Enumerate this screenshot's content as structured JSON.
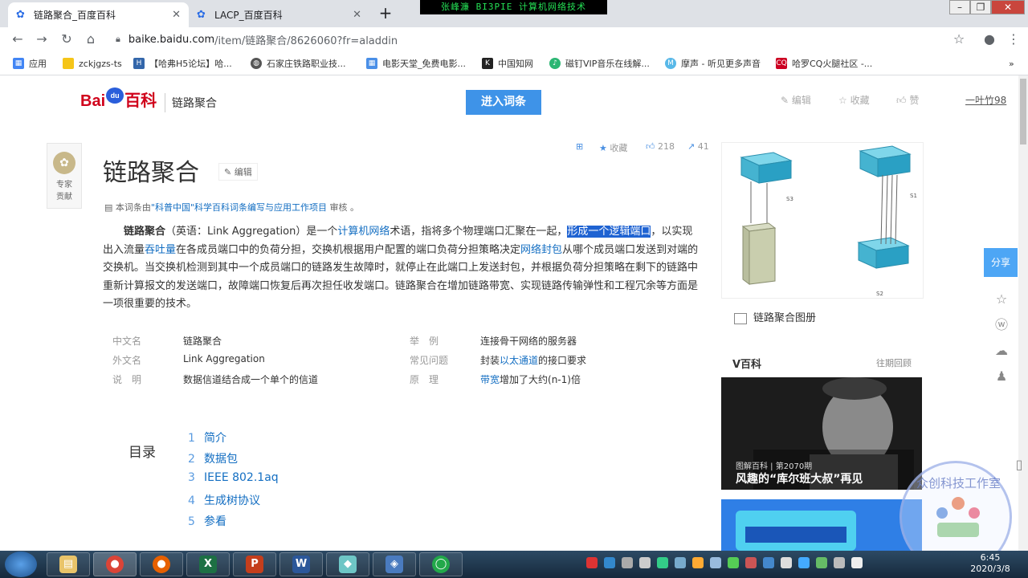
{
  "tabs": [
    {
      "label": "链路聚合_百度百科",
      "active": true
    },
    {
      "label": "LACP_百度百科",
      "active": false
    }
  ],
  "overlay_title": "张峰濂 BI3PIE 计算机网络技术",
  "address": {
    "host": "baike.baidu.com",
    "path": "/item/链路聚合/8626060?fr=aladdin"
  },
  "bookmarks": [
    "应用",
    "zckjgzs-ts",
    "【哈弗H5论坛】哈...",
    "石家庄铁路职业技...",
    "电影天堂_免费电影...",
    "中国知网",
    "磁钉VIP音乐在线解...",
    "摩声 - 听见更多声音",
    "哈罗CQ火腿社区 -..."
  ],
  "header": {
    "logo_main": "Bai",
    "logo_paw": "du",
    "logo_baike": "百科",
    "title": "链路聚合",
    "enter_button": "进入词条",
    "tools": [
      "编辑",
      "收藏",
      "赞"
    ],
    "user": "一叶竹98"
  },
  "contributor": {
    "label1": "专家",
    "label2": "贡献"
  },
  "article": {
    "title": "链路聚合",
    "edit": "编辑",
    "stats": {
      "favorite": "收藏",
      "likes": "218",
      "shares": "41"
    },
    "byline_prefix": "本词条由",
    "byline_link": "\"科普中国\"科学百科词条编写与应用工作项目",
    "byline_suffix": " 审核 。",
    "para": {
      "term": "链路聚合",
      "t1": "（英语：Link Aggregation）是一个",
      "l1": "计算机网络",
      "t2": "术语，指将多个物理端口汇聚在一起，",
      "sel": "形成一个逻辑端口",
      "t3": "，以实现出入流量",
      "l2": "吞吐量",
      "t4": "在各成员端口中的负荷分担，交换机根据用户配置的端口负荷分担策略决定",
      "l3": "网络封包",
      "t5": "从哪个成员端口发送到对端的交换机。当交换机检测到其中一个成员端口的链路发生故障时，就停止在此端口上发送封包，并根据负荷分担策略在剩下的链路中重新计算报文的发送端口，故障端口恢复后再次担任收发端口。链路聚合在增加链路带宽、实现链路传输弹性和工程冗余等方面是一项很重要的技术。"
    },
    "info_left": [
      {
        "k": "中文名",
        "v": "链路聚合"
      },
      {
        "k": "外文名",
        "v": "Link Aggregation"
      },
      {
        "k": "说　明",
        "v": "数据信道结合成一个单个的信道"
      }
    ],
    "info_right": [
      {
        "k": "举　例",
        "v": "连接骨干网络的服务器"
      },
      {
        "k": "常见问题",
        "v1": "封装",
        "link": "以太通道",
        "v2": "的接口要求"
      },
      {
        "k": "原　理",
        "link": "带宽",
        "v2": "增加了大约(n-1)倍"
      }
    ],
    "toc_title": "目录",
    "toc": [
      {
        "n": "1",
        "label": "简介"
      },
      {
        "n": "2",
        "label": "数据包"
      },
      {
        "n": "3",
        "label": "IEEE 802.1aq"
      },
      {
        "n": "4",
        "label": "生成树协议"
      },
      {
        "n": "5",
        "label": "参看"
      }
    ]
  },
  "sidebar": {
    "labels": [
      "S3",
      "S1",
      "S2"
    ],
    "album": "链路聚合图册",
    "vbaike": "V百科",
    "vbaike_old": "往期回顾",
    "video_cap1": "图解百科 | 第2070期",
    "video_cap2": "风趣的“库尔班大叔”再见",
    "share": "分享"
  },
  "watermark": "众创科技工作室",
  "clock": {
    "time": "6:45",
    "date": "2020/3/8"
  }
}
